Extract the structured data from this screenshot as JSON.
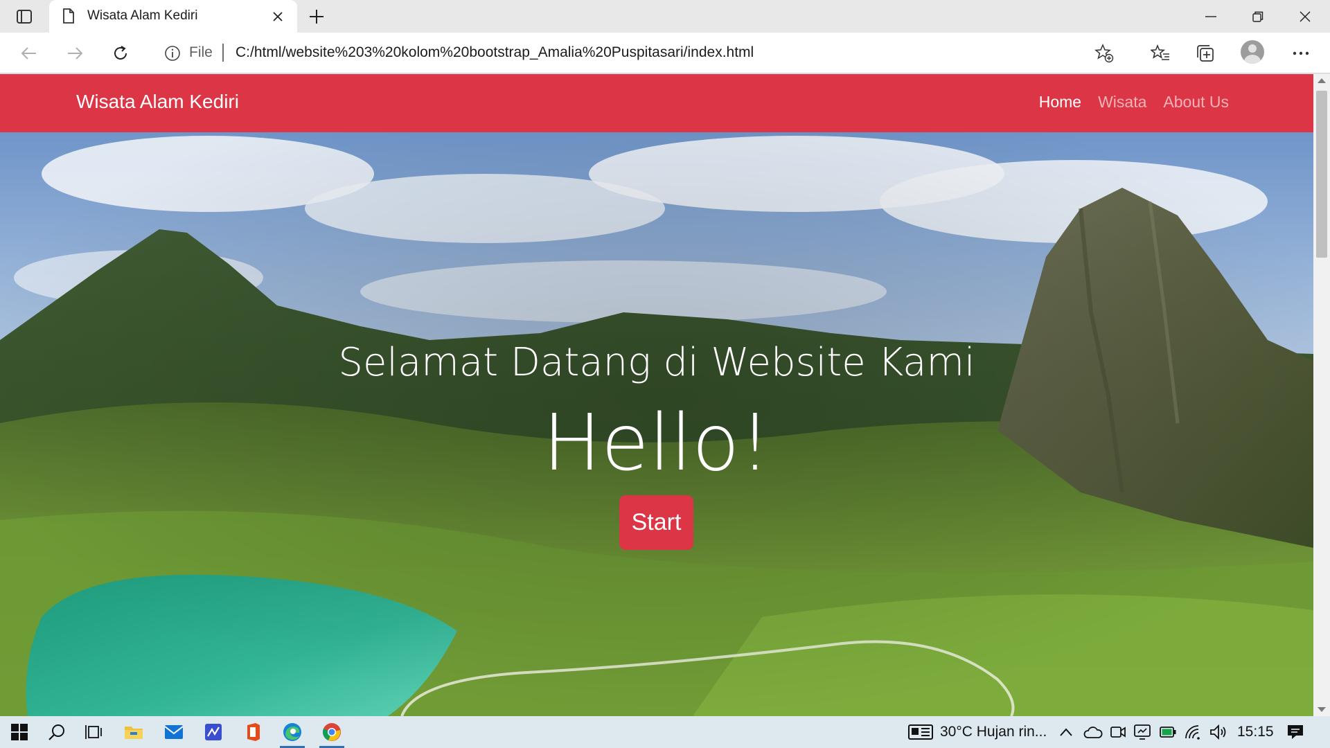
{
  "browser": {
    "tab_title": "Wisata Alam Kediri",
    "address_scheme": "File",
    "address_url": "C:/html/website%203%20kolom%20bootstrap_Amalia%20Puspitasari/index.html"
  },
  "page": {
    "brand": "Wisata Alam Kediri",
    "nav": [
      {
        "label": "Home",
        "active": true
      },
      {
        "label": "Wisata",
        "active": false
      },
      {
        "label": "About Us",
        "active": false
      }
    ],
    "hero": {
      "subtitle": "Selamat Datang di Website Kami",
      "title": "Hello!",
      "button_label": "Start"
    }
  },
  "taskbar": {
    "weather": "30°C  Hujan rin...",
    "time": "15:15"
  },
  "icons": [
    "tab-actions-icon",
    "page-icon",
    "close-icon",
    "plus-icon",
    "minimize-icon",
    "restore-icon",
    "back-icon",
    "forward-icon",
    "refresh-icon",
    "info-icon",
    "add-favorite-icon",
    "favorites-icon",
    "collections-icon",
    "profile-icon",
    "more-icon",
    "windows-icon",
    "search-icon",
    "task-view-icon",
    "file-explorer-icon",
    "mail-icon",
    "whiteboard-icon",
    "office-icon",
    "edge-icon",
    "chrome-icon",
    "news-icon",
    "chevron-up-icon",
    "onedrive-icon",
    "meet-icon",
    "screen-icon",
    "battery-icon",
    "wifi-icon",
    "volume-icon",
    "notification-icon"
  ],
  "colors": {
    "navbar": "#dc3545",
    "button": "#dc3545",
    "taskbar": "#dde9ef"
  }
}
